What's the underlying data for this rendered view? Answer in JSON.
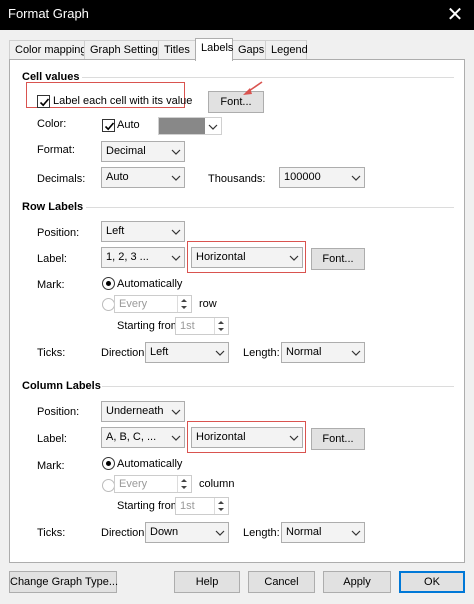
{
  "window": {
    "title": "Format Graph",
    "close_glyph": "✕"
  },
  "tabs": [
    {
      "label": "Color mapping"
    },
    {
      "label": "Graph Settings"
    },
    {
      "label": "Titles"
    },
    {
      "label": "Labels",
      "active": true
    },
    {
      "label": "Gaps"
    },
    {
      "label": "Legend"
    }
  ],
  "cell_values": {
    "title": "Cell values",
    "label_each_cell": "Label each cell with its value",
    "label_each_cell_checked": true,
    "font_button": "Font...",
    "color_label": "Color:",
    "color_auto": "Auto",
    "color_auto_checked": true,
    "color_swatch": "#888888",
    "format_label": "Format:",
    "format_value": "Decimal",
    "decimals_label": "Decimals:",
    "decimals_value": "Auto",
    "thousands_label": "Thousands:",
    "thousands_value": "100000"
  },
  "row_labels": {
    "title": "Row Labels",
    "position_label": "Position:",
    "position_value": "Left",
    "label_label": "Label:",
    "label_value": "1, 2, 3 ...",
    "orientation_value": "Horizontal",
    "font_button": "Font...",
    "mark_label": "Mark:",
    "mark_auto": "Automatically",
    "mark_every": "Every",
    "mark_unit": "row",
    "starting_from_label": "Starting from",
    "starting_from_value": "1st",
    "ticks_label": "Ticks:",
    "direction_label": "Direction:",
    "direction_value": "Left",
    "length_label": "Length:",
    "length_value": "Normal"
  },
  "column_labels": {
    "title": "Column Labels",
    "position_label": "Position:",
    "position_value": "Underneath",
    "label_label": "Label:",
    "label_value": "A, B, C, ...",
    "orientation_value": "Horizontal",
    "font_button": "Font...",
    "mark_label": "Mark:",
    "mark_auto": "Automatically",
    "mark_every": "Every",
    "mark_unit": "column",
    "starting_from_label": "Starting from",
    "starting_from_value": "1st",
    "ticks_label": "Ticks:",
    "direction_label": "Direction:",
    "direction_value": "Down",
    "length_label": "Length:",
    "length_value": "Normal"
  },
  "footer": {
    "change_type": "Change Graph Type...",
    "help": "Help",
    "cancel": "Cancel",
    "apply": "Apply",
    "ok": "OK"
  },
  "colors": {
    "titlebar": "#000000",
    "highlight_box": "#d9534f",
    "default_button_border": "#0078d7"
  }
}
